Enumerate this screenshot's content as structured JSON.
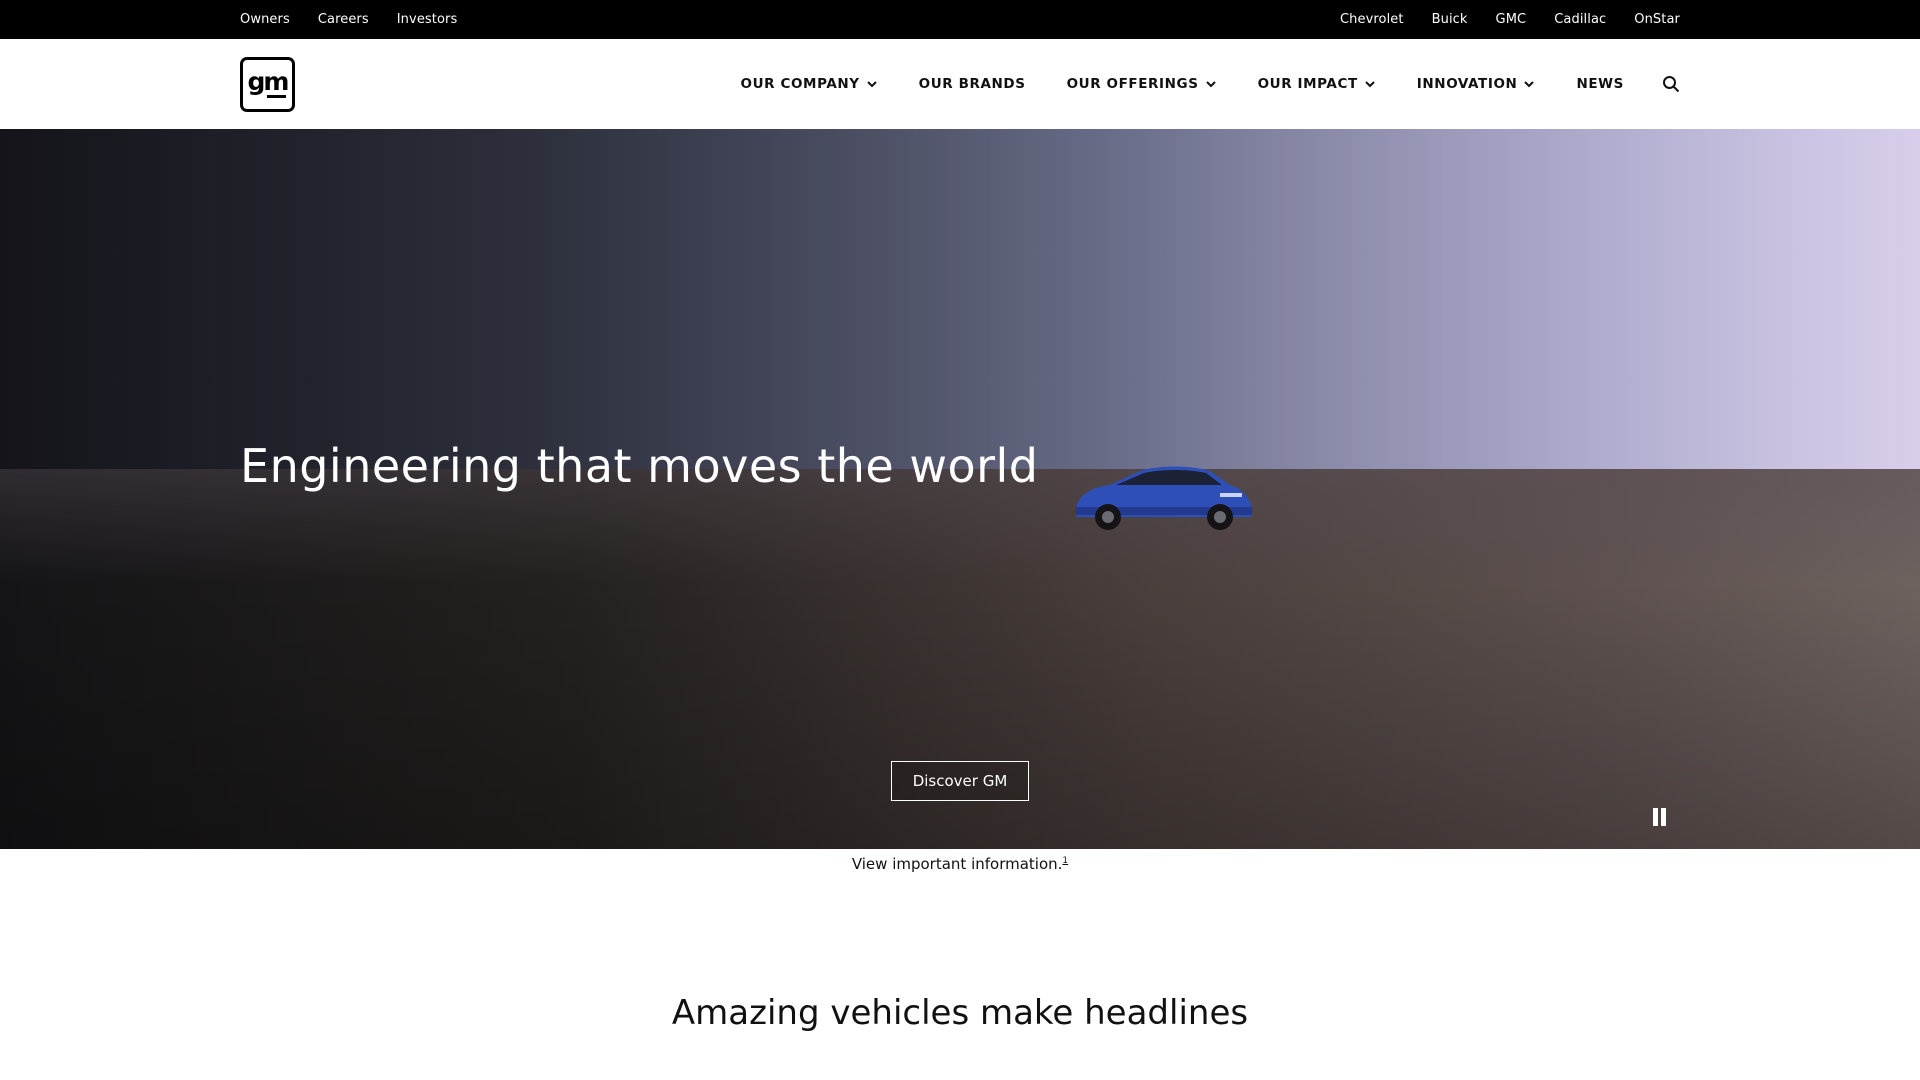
{
  "utility_nav": {
    "left": [
      "Owners",
      "Careers",
      "Investors"
    ],
    "right": [
      "Chevrolet",
      "Buick",
      "GMC",
      "Cadillac",
      "OnStar"
    ]
  },
  "header": {
    "logo_text": "gm",
    "nav": [
      {
        "label": "OUR COMPANY",
        "dropdown": true
      },
      {
        "label": "OUR BRANDS",
        "dropdown": false
      },
      {
        "label": "OUR OFFERINGS",
        "dropdown": true
      },
      {
        "label": "OUR IMPACT",
        "dropdown": true
      },
      {
        "label": "INNOVATION",
        "dropdown": true
      },
      {
        "label": "NEWS",
        "dropdown": false
      }
    ],
    "search_icon": "search-icon"
  },
  "hero": {
    "title": "Engineering that moves the world",
    "cta_label": "Discover GM",
    "video_control": "pause-icon"
  },
  "info": {
    "text": "View important information.",
    "footnote": "1"
  },
  "section": {
    "heading": "Amazing vehicles make headlines"
  }
}
